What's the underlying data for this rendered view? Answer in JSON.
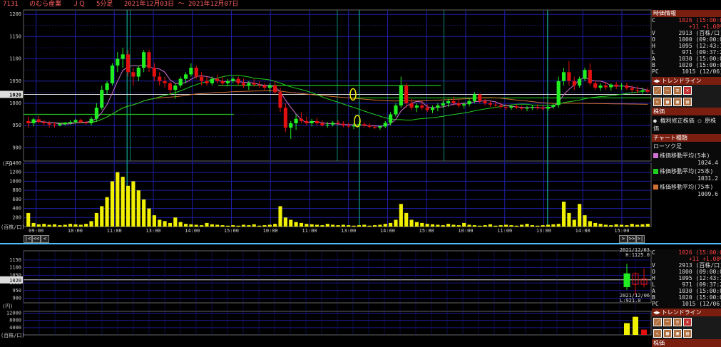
{
  "header": {
    "code": "7131",
    "name": "のむら産業",
    "market": "ＪＱ",
    "timeframe": "5分足",
    "range": "2021年12月03日 ～ 2021年12月07日"
  },
  "current_price_label": "1020",
  "unit_label": "(円)",
  "volume_unit_label": "(百株/口)",
  "colors": {
    "background": "#000000",
    "grid": "#1f1fa8",
    "session": "#0fa890",
    "up_candle": "#21ee21",
    "down_candle": "#e21010",
    "volume": "#f0f000",
    "ma5": "#d070d0",
    "ma25": "#20d020",
    "ma75": "#d07030",
    "trendline": "#20c020",
    "marker": "#f0f000"
  },
  "quote_panel": {
    "title": "時価情報",
    "rows": [
      {
        "label": "C",
        "value": "1026 (15:00:0"
      },
      {
        "label": "",
        "value": "+11 +1.08%"
      },
      {
        "label": "V",
        "value": "2913 (百株/口)"
      },
      {
        "label": "O",
        "value": "1000 (09:00:0"
      },
      {
        "label": "H",
        "value": "1095 (12:43:1"
      },
      {
        "label": "L",
        "value": "971 (09:37:2"
      },
      {
        "label": "A",
        "value": "1030 (15:00:0"
      },
      {
        "label": "B",
        "value": "1020 (15:00:0"
      },
      {
        "label": "PC",
        "value": "1015 (12/06)"
      }
    ],
    "trendline_title": "トレンドライン",
    "price_type_title": "株価",
    "price_options": [
      "権利修正株価",
      "原株価"
    ],
    "chart_type_title": "チャート種類",
    "chart_type_value": "ローソク足",
    "ma_lines": [
      {
        "name": "株価移動平均(5本)",
        "value": "1024.4"
      },
      {
        "name": "株価移動平均(25本)",
        "value": "1031.2"
      },
      {
        "name": "株価移動平均(75本)",
        "value": "1009.6"
      }
    ]
  },
  "lower_panel": {
    "hilo_top": "2021/12/03",
    "hilo_high": "H:1125.0",
    "hilo_date2": "2021/12/06",
    "hilo_low": "L:921.0",
    "trendline_title": "トレンドライン",
    "bottom_title": "株価"
  },
  "chart_data": {
    "type": "candlestick",
    "price_ylim": [
      870,
      1210
    ],
    "price_ticks": [
      900,
      950,
      1000,
      1050,
      1100,
      1150,
      1200
    ],
    "volume_ylim": [
      0,
      1400
    ],
    "volume_ticks": [
      200,
      400,
      600,
      800,
      1000,
      1200,
      1400
    ],
    "time_labels": [
      "09:00",
      "10:00",
      "11:00",
      "13:00",
      "14:00",
      "15:00",
      "10:00",
      "11:00",
      "13:00",
      "14:00",
      "15:00",
      "10:00",
      "11:00",
      "13:00",
      "14:00",
      "15:00"
    ],
    "horizontal_line": 1020,
    "candles": [
      [
        960,
        970,
        945,
        955
      ],
      [
        955,
        968,
        948,
        964
      ],
      [
        964,
        972,
        955,
        958
      ],
      [
        958,
        962,
        950,
        955
      ],
      [
        955,
        960,
        945,
        952
      ],
      [
        952,
        958,
        945,
        950
      ],
      [
        950,
        955,
        948,
        953
      ],
      [
        953,
        958,
        950,
        956
      ],
      [
        956,
        962,
        952,
        958
      ],
      [
        958,
        965,
        954,
        962
      ],
      [
        962,
        965,
        955,
        957
      ],
      [
        957,
        960,
        952,
        955
      ],
      [
        955,
        970,
        950,
        965
      ],
      [
        965,
        1000,
        960,
        990
      ],
      [
        990,
        1040,
        985,
        1030
      ],
      [
        1030,
        1050,
        1020,
        1045
      ],
      [
        1045,
        1090,
        1040,
        1085
      ],
      [
        1085,
        1115,
        1070,
        1100
      ],
      [
        1100,
        1125,
        1080,
        1110
      ],
      [
        1110,
        1120,
        1060,
        1070
      ],
      [
        1070,
        1080,
        1040,
        1060
      ],
      [
        1060,
        1085,
        1050,
        1080
      ],
      [
        1080,
        1120,
        1070,
        1115
      ],
      [
        1115,
        1120,
        1070,
        1080
      ],
      [
        1080,
        1090,
        1050,
        1060
      ],
      [
        1060,
        1070,
        1040,
        1050
      ],
      [
        1050,
        1060,
        1035,
        1045
      ],
      [
        1045,
        1050,
        1020,
        1030
      ],
      [
        1030,
        1045,
        1010,
        1040
      ],
      [
        1040,
        1060,
        1035,
        1055
      ],
      [
        1055,
        1070,
        1045,
        1065
      ],
      [
        1065,
        1090,
        1060,
        1080
      ],
      [
        1080,
        1085,
        1055,
        1060
      ],
      [
        1060,
        1070,
        1040,
        1050
      ],
      [
        1050,
        1060,
        1040,
        1045
      ],
      [
        1045,
        1060,
        1040,
        1055
      ],
      [
        1055,
        1065,
        1045,
        1050
      ],
      [
        1050,
        1060,
        1040,
        1045
      ],
      [
        1045,
        1055,
        1038,
        1050
      ],
      [
        1050,
        1060,
        1045,
        1055
      ],
      [
        1055,
        1060,
        1040,
        1045
      ],
      [
        1045,
        1055,
        1035,
        1040
      ],
      [
        1040,
        1050,
        1030,
        1045
      ],
      [
        1045,
        1055,
        1038,
        1042
      ],
      [
        1042,
        1050,
        1035,
        1040
      ],
      [
        1040,
        1045,
        1030,
        1035
      ],
      [
        1035,
        1045,
        1025,
        1040
      ],
      [
        1040,
        1050,
        1020,
        1025
      ],
      [
        1025,
        1035,
        980,
        990
      ],
      [
        990,
        1000,
        935,
        945
      ],
      [
        945,
        960,
        920,
        955
      ],
      [
        955,
        975,
        940,
        965
      ],
      [
        965,
        980,
        955,
        960
      ],
      [
        960,
        970,
        950,
        955
      ],
      [
        955,
        965,
        948,
        960
      ],
      [
        960,
        968,
        950,
        955
      ],
      [
        955,
        962,
        948,
        950
      ],
      [
        950,
        958,
        945,
        952
      ],
      [
        952,
        960,
        948,
        956
      ],
      [
        956,
        962,
        950,
        954
      ],
      [
        954,
        960,
        946,
        950
      ],
      [
        950,
        956,
        944,
        948
      ],
      [
        948,
        955,
        942,
        950
      ],
      [
        950,
        958,
        945,
        953
      ],
      [
        953,
        958,
        946,
        950
      ],
      [
        950,
        955,
        944,
        947
      ],
      [
        947,
        952,
        942,
        945
      ],
      [
        945,
        950,
        940,
        948
      ],
      [
        948,
        960,
        944,
        956
      ],
      [
        956,
        980,
        950,
        975
      ],
      [
        975,
        1000,
        970,
        995
      ],
      [
        995,
        1060,
        990,
        1040
      ],
      [
        1040,
        1045,
        990,
        1000
      ],
      [
        1000,
        1010,
        985,
        990
      ],
      [
        990,
        1000,
        980,
        995
      ],
      [
        995,
        1005,
        985,
        990
      ],
      [
        990,
        998,
        980,
        985
      ],
      [
        985,
        995,
        978,
        990
      ],
      [
        990,
        1000,
        982,
        995
      ],
      [
        995,
        1005,
        990,
        1000
      ],
      [
        1000,
        1010,
        992,
        1005
      ],
      [
        1005,
        1015,
        995,
        1000
      ],
      [
        1000,
        1008,
        990,
        995
      ],
      [
        995,
        1003,
        988,
        998
      ],
      [
        998,
        1010,
        993,
        1005
      ],
      [
        1005,
        1025,
        1000,
        1020
      ],
      [
        1020,
        1022,
        1000,
        1005
      ],
      [
        1005,
        1010,
        995,
        1000
      ],
      [
        1000,
        1005,
        992,
        997
      ],
      [
        997,
        1003,
        990,
        995
      ],
      [
        995,
        1002,
        988,
        992
      ],
      [
        992,
        998,
        985,
        990
      ],
      [
        990,
        997,
        985,
        993
      ],
      [
        993,
        998,
        987,
        990
      ],
      [
        990,
        995,
        984,
        988
      ],
      [
        988,
        994,
        982,
        990
      ],
      [
        990,
        996,
        985,
        992
      ],
      [
        992,
        998,
        986,
        990
      ],
      [
        990,
        996,
        984,
        988
      ],
      [
        988,
        995,
        983,
        992
      ],
      [
        992,
        1000,
        988,
        996
      ],
      [
        996,
        1060,
        990,
        1050
      ],
      [
        1050,
        1080,
        1040,
        1070
      ],
      [
        1070,
        1095,
        1040,
        1050
      ],
      [
        1050,
        1060,
        1030,
        1040
      ],
      [
        1040,
        1060,
        1035,
        1055
      ],
      [
        1055,
        1080,
        1050,
        1075
      ],
      [
        1075,
        1090,
        1040,
        1045
      ],
      [
        1045,
        1050,
        1030,
        1035
      ],
      [
        1035,
        1045,
        1028,
        1040
      ],
      [
        1040,
        1048,
        1030,
        1036
      ],
      [
        1036,
        1045,
        1028,
        1042
      ],
      [
        1042,
        1048,
        1032,
        1038
      ],
      [
        1038,
        1045,
        1030,
        1040
      ],
      [
        1040,
        1046,
        1030,
        1034
      ],
      [
        1034,
        1040,
        1025,
        1030
      ],
      [
        1030,
        1038,
        1022,
        1028
      ],
      [
        1028,
        1035,
        1020,
        1030
      ],
      [
        1030,
        1036,
        1022,
        1026
      ]
    ],
    "volumes": [
      300,
      80,
      50,
      60,
      40,
      50,
      30,
      40,
      60,
      50,
      40,
      60,
      120,
      300,
      450,
      650,
      1000,
      1200,
      1100,
      900,
      1000,
      800,
      600,
      400,
      250,
      150,
      120,
      80,
      200,
      100,
      60,
      50,
      40,
      30,
      80,
      50,
      40,
      30,
      20,
      30,
      20,
      40,
      30,
      50,
      20,
      30,
      40,
      60,
      450,
      200,
      150,
      100,
      80,
      60,
      50,
      40,
      30,
      60,
      40,
      30,
      40,
      30,
      20,
      30,
      40,
      20,
      30,
      40,
      60,
      80,
      150,
      500,
      300,
      150,
      100,
      80,
      60,
      50,
      40,
      30,
      60,
      40,
      30,
      80,
      40,
      30,
      20,
      30,
      50,
      20,
      30,
      40,
      30,
      20,
      40,
      60,
      30,
      20,
      30,
      40,
      50,
      60,
      550,
      300,
      150,
      500,
      250,
      120,
      80,
      60,
      40,
      30,
      50,
      40,
      30,
      60,
      40,
      50,
      60,
      40,
      30
    ]
  }
}
